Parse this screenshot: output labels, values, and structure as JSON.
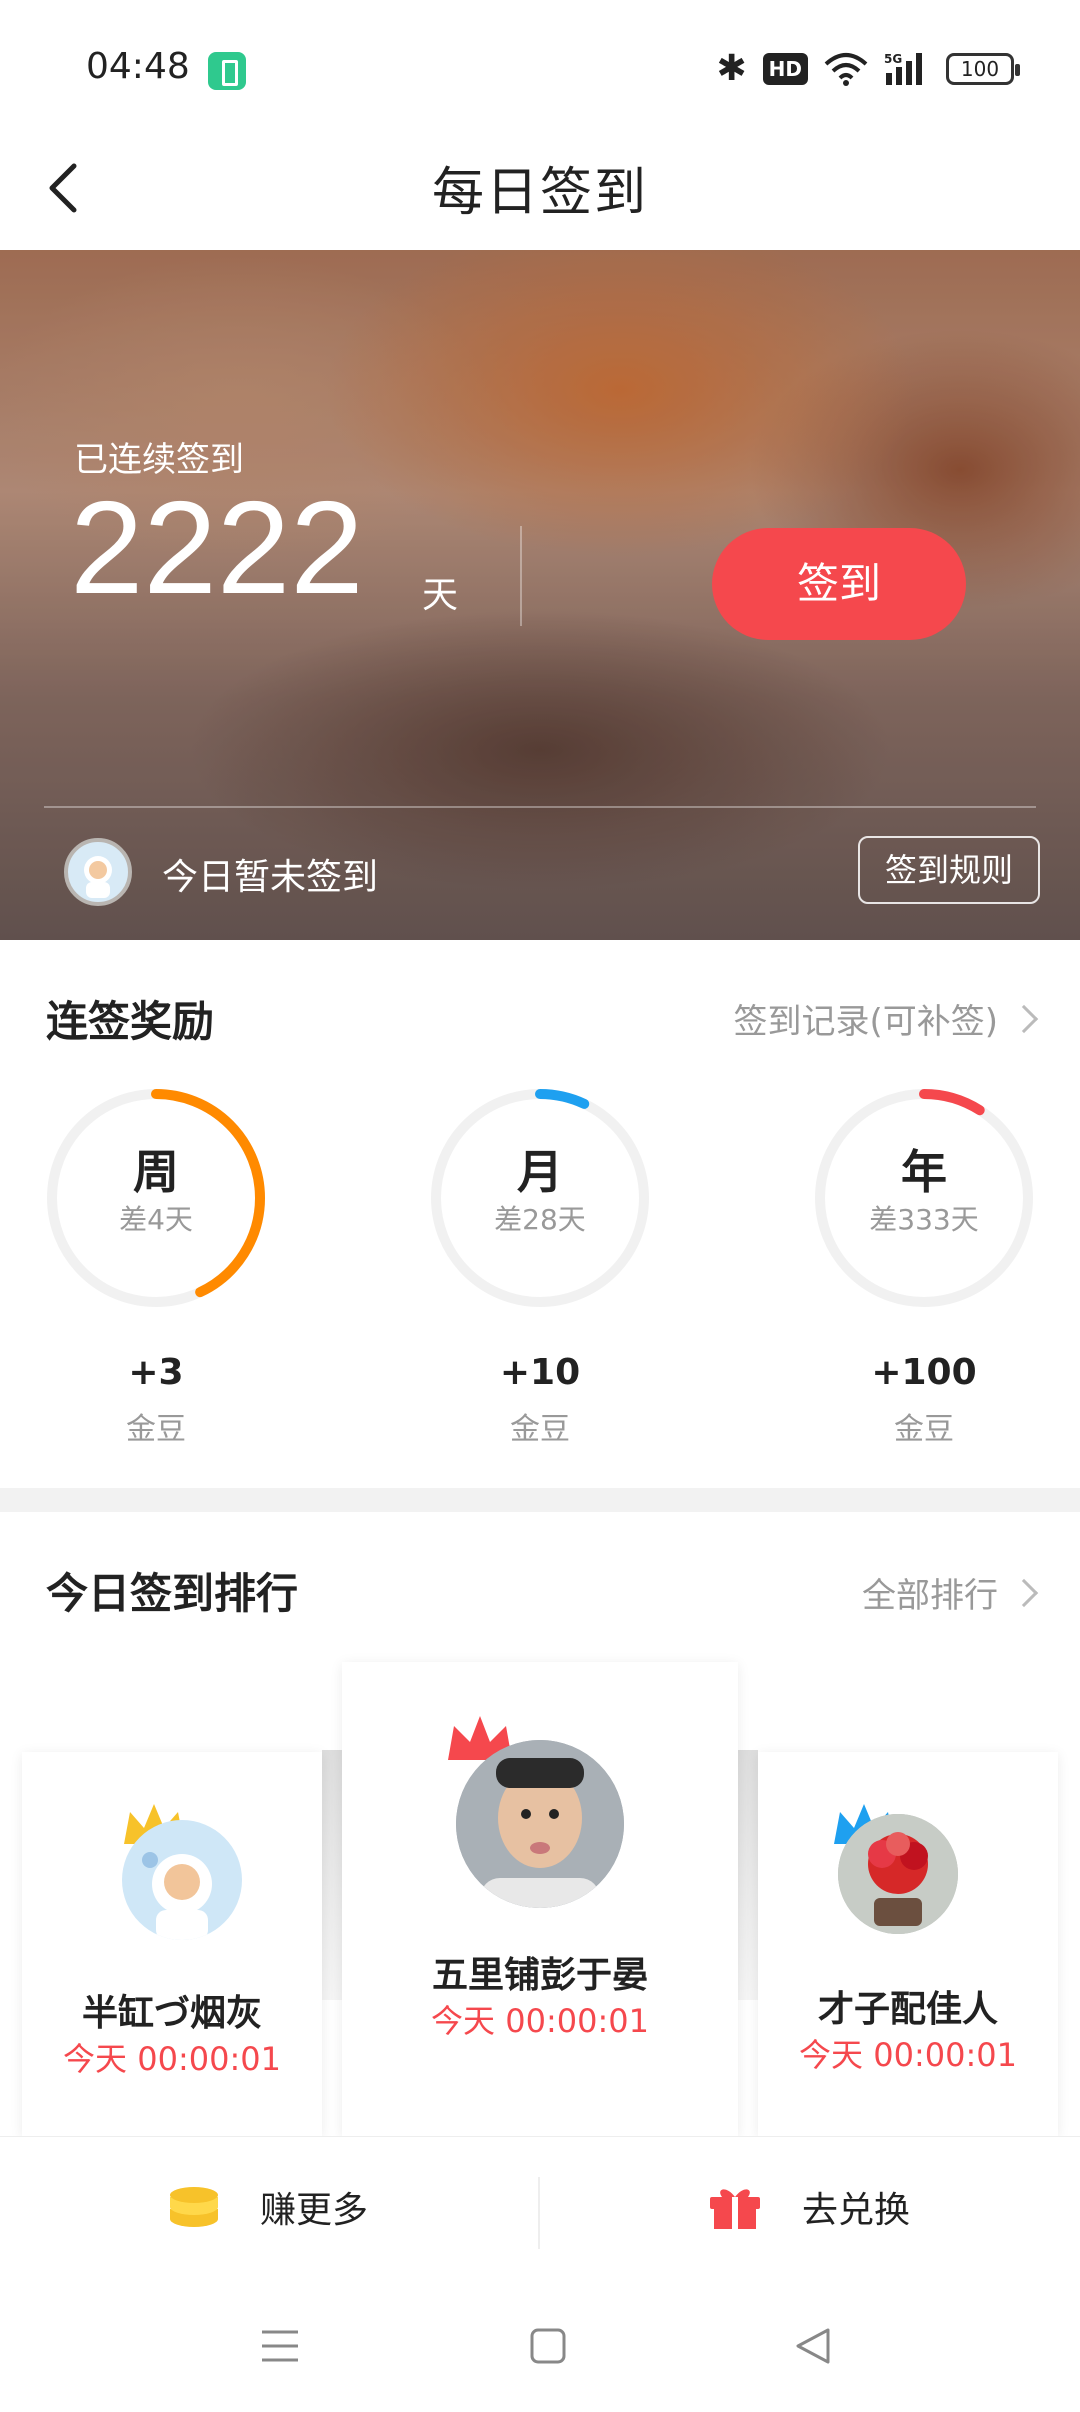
{
  "status_bar": {
    "time": "04:48",
    "battery": "100",
    "hd": "HD",
    "signal_type": "5G"
  },
  "nav": {
    "title": "每日签到"
  },
  "banner": {
    "streak_label": "已连续签到",
    "streak_days": "2222",
    "streak_unit": "天",
    "checkin_button": "签到",
    "today_status": "今日暂未签到",
    "rules_button": "签到规则"
  },
  "streak_rewards": {
    "title": "连签奖励",
    "record_link": "签到记录(可补签)",
    "items": [
      {
        "label": "周",
        "remaining": "差4天",
        "amount": "+3",
        "unit": "金豆",
        "progress": 0.43,
        "color": "#ff8a00"
      },
      {
        "label": "月",
        "remaining": "差28天",
        "amount": "+10",
        "unit": "金豆",
        "progress": 0.07,
        "color": "#1ea0f0"
      },
      {
        "label": "年",
        "remaining": "差333天",
        "amount": "+100",
        "unit": "金豆",
        "progress": 0.09,
        "color": "#f5484d"
      }
    ]
  },
  "ranking": {
    "title": "今日签到排行",
    "all_link": "全部排行",
    "entries": [
      {
        "rank": 1,
        "name": "五里铺彭于晏",
        "time": "今天 00:00:01",
        "crown_color": "#f5484d"
      },
      {
        "rank": 2,
        "name": "半缸づ烟灰",
        "time": "今天 00:00:01",
        "crown_color": "#f7c22a"
      },
      {
        "rank": 3,
        "name": "才子配佳人",
        "time": "今天 00:00:01",
        "crown_color": "#1ea0f0"
      }
    ]
  },
  "bottom_bar": {
    "earn_more": "赚更多",
    "redeem": "去兑换"
  }
}
